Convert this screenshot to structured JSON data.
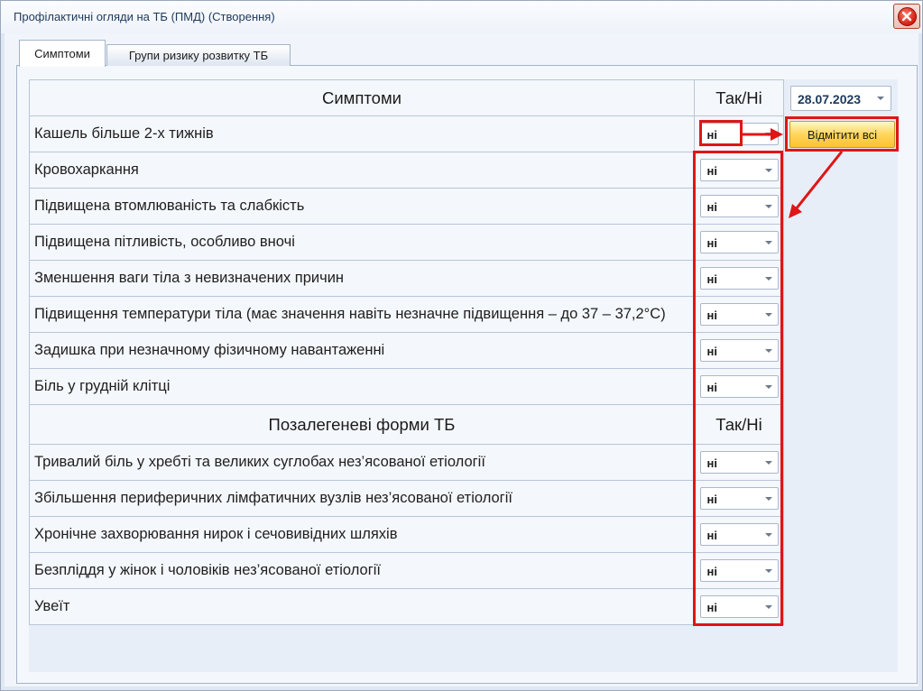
{
  "window": {
    "title": "Профілактичні огляди на ТБ (ПМД) (Створення)",
    "close_icon": "close-icon"
  },
  "tabs": [
    {
      "label": "Симптоми",
      "active": true
    },
    {
      "label": "Групи ризику розвитку ТБ",
      "active": false
    }
  ],
  "date_picker": {
    "value": "28.07.2023"
  },
  "mark_all_button": {
    "label": "Відмітити всі"
  },
  "symptoms_section": {
    "header": "Симптоми",
    "value_header": "Так/Ні",
    "items": [
      {
        "label": "Кашель більше 2-х тижнів",
        "value": "ні"
      },
      {
        "label": "Кровохаркання",
        "value": "ні"
      },
      {
        "label": "Підвищена втомлюваність та слабкість",
        "value": "ні"
      },
      {
        "label": "Підвищена пітливість, особливо вночі",
        "value": "ні"
      },
      {
        "label": "Зменшення ваги тіла з невизначених причин",
        "value": "ні"
      },
      {
        "label": "Підвищення температури тіла (має значення навіть незначне підвищення – до 37 – 37,2°С)",
        "value": "ні"
      },
      {
        "label": "Задишка при незначному фізичному навантаженні",
        "value": "ні"
      },
      {
        "label": "Біль у грудній клітці",
        "value": "ні"
      }
    ]
  },
  "extrapulmonary_section": {
    "header": "Позалегеневі форми ТБ",
    "value_header": "Так/Ні",
    "items": [
      {
        "label": "Тривалий біль у хребті та великих суглобах нез’ясованої етіології",
        "value": "ні"
      },
      {
        "label": "Збільшення периферичних лімфатичних вузлів нез’ясованої етіології",
        "value": "ні"
      },
      {
        "label": "Хронічне захворювання нирок і сечовивідних шляхів",
        "value": "ні"
      },
      {
        "label": "Безпліддя у жінок і чоловіків нез’ясованої етіології",
        "value": "ні"
      },
      {
        "label": "Увеїт",
        "value": "ні"
      }
    ]
  },
  "annotation_color": "#e01515"
}
